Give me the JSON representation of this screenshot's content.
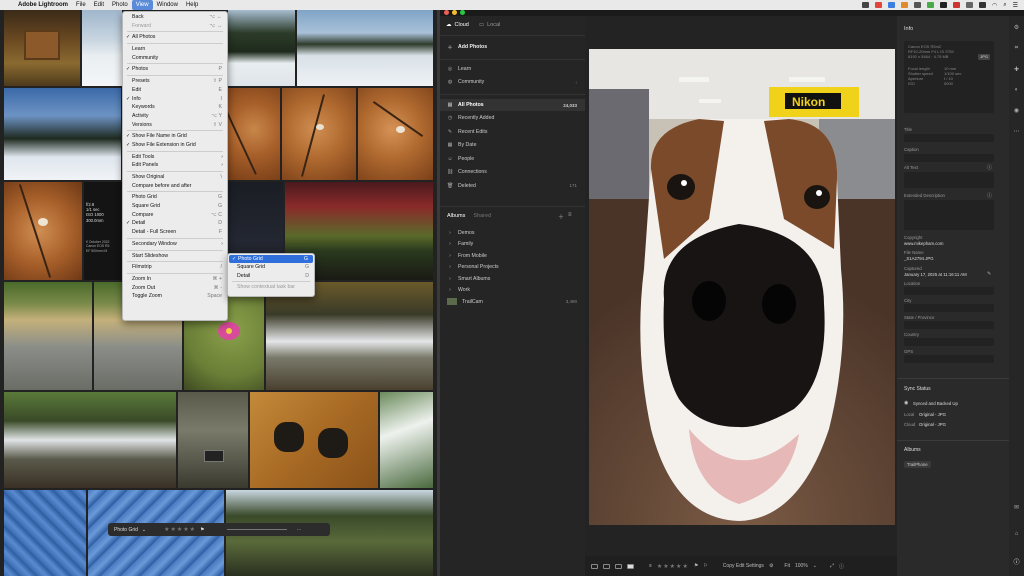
{
  "menubar": {
    "app_name": "Adobe Lightroom",
    "items": [
      "File",
      "Edit",
      "Photo",
      "View",
      "Window",
      "Help"
    ],
    "active_item": "View",
    "search_label": "Search"
  },
  "view_menu": {
    "items": [
      {
        "label": "Back",
        "shortcut": "⌥ ←",
        "disabled": false
      },
      {
        "label": "Forward",
        "shortcut": "⌥ →",
        "disabled": true
      },
      {
        "divider": true
      },
      {
        "label": "All Photos",
        "checked": true
      },
      {
        "divider": true
      },
      {
        "label": "Learn"
      },
      {
        "label": "Community"
      },
      {
        "divider": true
      },
      {
        "label": "Photos",
        "checked": true,
        "shortcut": "P"
      },
      {
        "divider": true
      },
      {
        "label": "Presets",
        "shortcut": "⇧ P"
      },
      {
        "label": "Edit",
        "shortcut": "E"
      },
      {
        "label": "Info",
        "checked": true,
        "shortcut": "I"
      },
      {
        "label": "Keywords",
        "shortcut": "K"
      },
      {
        "label": "Activity",
        "shortcut": "⌥ Y"
      },
      {
        "label": "Versions",
        "shortcut": "⇧ V"
      },
      {
        "divider": true
      },
      {
        "label": "Show File Name in Grid",
        "checked": true
      },
      {
        "label": "Show File Extension in Grid",
        "checked": true
      },
      {
        "divider": true
      },
      {
        "label": "Edit Tools",
        "submenu": true
      },
      {
        "label": "Edit Panels",
        "submenu": true
      },
      {
        "divider": true
      },
      {
        "label": "Show Original",
        "shortcut": "\\"
      },
      {
        "label": "Compare before and after"
      },
      {
        "divider": true
      },
      {
        "label": "Photo Grid",
        "shortcut": "G"
      },
      {
        "label": "Square Grid",
        "shortcut": "G"
      },
      {
        "label": "Compare",
        "shortcut": "⌥ C"
      },
      {
        "label": "Detail",
        "checked": true,
        "shortcut": "D"
      },
      {
        "label": "Detail - Full Screen",
        "shortcut": "F"
      },
      {
        "divider": true
      },
      {
        "label": "Secondary Window",
        "submenu": true
      },
      {
        "divider": true
      },
      {
        "label": "Start Slideshow"
      },
      {
        "divider": true
      },
      {
        "label": "Filmstrip",
        "shortcut": "/"
      },
      {
        "divider": true
      },
      {
        "label": "Zoom In",
        "shortcut": "⌘ +"
      },
      {
        "label": "Zoom Out",
        "shortcut": "⌘ -"
      },
      {
        "label": "Toggle Zoom",
        "shortcut": "Space"
      }
    ]
  },
  "secondary_submenu": {
    "items": [
      {
        "label": "Photo Grid",
        "checked": true,
        "shortcut": "G",
        "highlighted": true
      },
      {
        "label": "Square Grid",
        "shortcut": "G"
      },
      {
        "label": "Detail",
        "shortcut": "D"
      },
      {
        "divider": true
      },
      {
        "label": "Show contextual task bar",
        "disabled": true
      }
    ]
  },
  "grid_overlay": {
    "exif": [
      "f/2.8",
      "1/1 sec",
      "ISO 1000",
      "300.0mm"
    ],
    "exif_side": [
      "f/ October 2022",
      "Canon EOS R5",
      "EF 500mm f/4"
    ]
  },
  "float_toolbar": {
    "view_label": "Photo Grid",
    "stars": "★★★★★"
  },
  "sidebar": {
    "tabs": [
      {
        "label": "Cloud",
        "active": true
      },
      {
        "label": "Local",
        "active": false
      }
    ],
    "add_photos": "Add Photos",
    "learn": "Learn",
    "community": "Community",
    "all_photos": {
      "label": "All Photos",
      "count": "24,033"
    },
    "library": [
      {
        "label": "Recently Added",
        "icon": "clock-icon"
      },
      {
        "label": "Recent Edits",
        "icon": "edit-icon"
      },
      {
        "label": "By Date",
        "icon": "calendar-icon"
      },
      {
        "label": "People",
        "icon": "person-icon"
      },
      {
        "label": "Connections",
        "icon": "link-icon"
      },
      {
        "label": "Deleted",
        "icon": "trash-icon",
        "count": "171"
      }
    ],
    "albums_tab": "Albums",
    "shared_tab": "Shared",
    "albums": [
      {
        "label": "Demos"
      },
      {
        "label": "Family"
      },
      {
        "label": "From Mobile"
      },
      {
        "label": "Personal Projects"
      },
      {
        "label": "Smart Albums"
      },
      {
        "label": "Work"
      },
      {
        "label": "TrailCam",
        "count": "3,490"
      }
    ]
  },
  "bottombar": {
    "stars": "★★★★★",
    "copy_label": "Copy Edit Settings",
    "fit_label": "Fit",
    "zoom": "100%"
  },
  "info": {
    "title": "Info",
    "camera": "Canon EOS R5m2",
    "lens": "RF10-20mm F4 L IS STM",
    "dims": "8192 x 5464 · 4.75 MB",
    "file_type": "JPG",
    "rows": [
      {
        "k": "Focal length",
        "v": "10 mm"
      },
      {
        "k": "Shutter speed",
        "v": "1/100 sec"
      },
      {
        "k": "Aperture",
        "v": "f / 10"
      },
      {
        "k": "ISO",
        "v": "5000"
      }
    ],
    "title_label": "Title",
    "caption_label": "Caption",
    "alt_text_label": "Alt Text",
    "ext_desc_label": "Extended Description",
    "copyright_label": "Copyright",
    "copyright_value": "www.mikepham.com",
    "filename_label": "File Name",
    "filename_value": "_S1A2794.JPG",
    "captured_label": "Captured",
    "captured_value": "January 17, 2025 at 11:16:11 AM",
    "location_label": "Location",
    "city_label": "City",
    "state_label": "State / Province",
    "country_label": "Country",
    "gps_label": "GPS",
    "sync_title": "Sync Status",
    "sync_status": "Synced and Backed Up",
    "local_label": "Local",
    "local_value": "Original - JPG",
    "cloud_label": "Cloud",
    "cloud_value": "Original - JPG",
    "albums_title": "Albums",
    "album_pill": "TrailPhone"
  }
}
